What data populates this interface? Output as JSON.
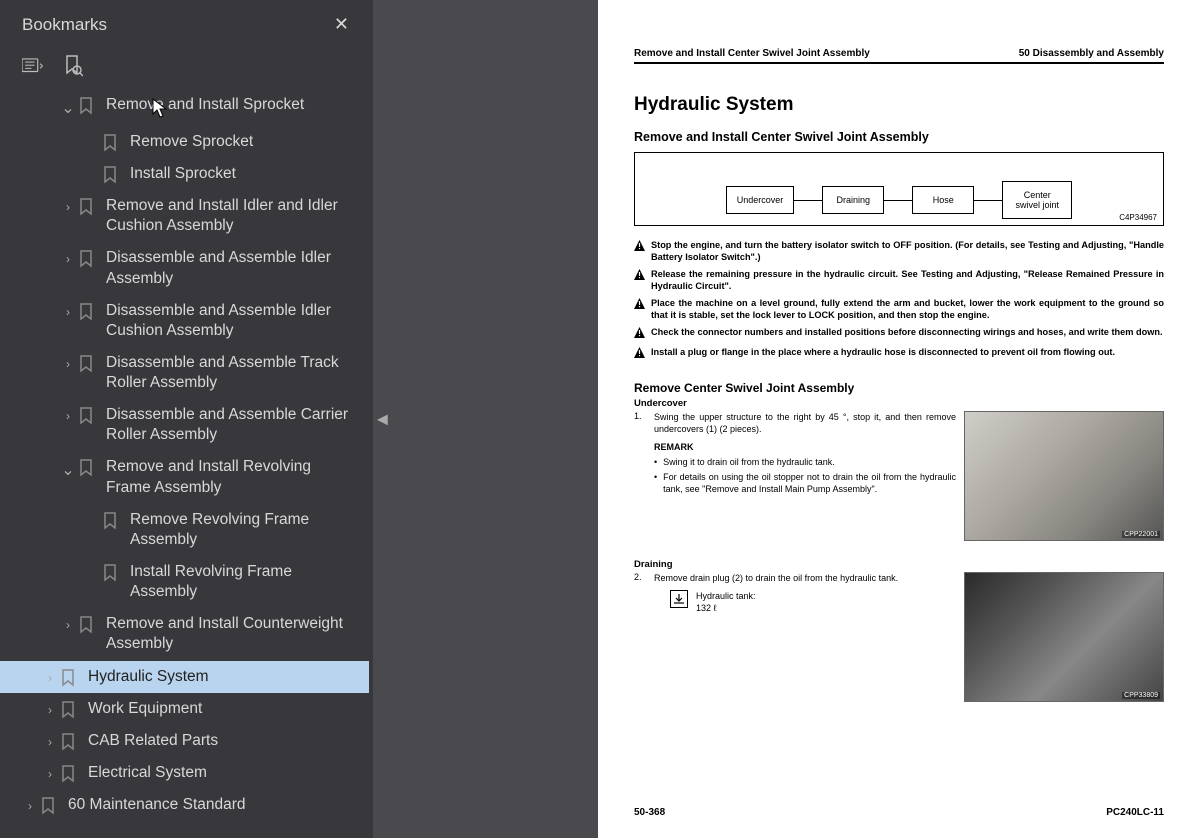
{
  "sidebar": {
    "title": "Bookmarks",
    "items": [
      {
        "indent": 3,
        "chev": "down",
        "label": "Remove and Install Sprocket"
      },
      {
        "indent": 4,
        "chev": "",
        "label": "Remove Sprocket"
      },
      {
        "indent": 4,
        "chev": "",
        "label": "Install Sprocket"
      },
      {
        "indent": 3,
        "chev": "right",
        "label": "Remove and Install Idler and Idler Cushion Assembly"
      },
      {
        "indent": 3,
        "chev": "right",
        "label": "Disassemble and Assemble Idler Assembly"
      },
      {
        "indent": 3,
        "chev": "right",
        "label": "Disassemble and Assemble Idler Cushion Assembly"
      },
      {
        "indent": 3,
        "chev": "right",
        "label": "Disassemble and Assemble Track Roller Assembly"
      },
      {
        "indent": 3,
        "chev": "right",
        "label": "Disassemble and Assemble Carrier Roller Assembly"
      },
      {
        "indent": 3,
        "chev": "down",
        "label": "Remove and Install Revolving Frame Assembly"
      },
      {
        "indent": 4,
        "chev": "",
        "label": "Remove Revolving Frame Assembly"
      },
      {
        "indent": 4,
        "chev": "",
        "label": "Install Revolving Frame Assembly"
      },
      {
        "indent": 3,
        "chev": "right",
        "label": "Remove and Install Counterweight Assembly"
      },
      {
        "indent": 2,
        "chev": "right",
        "label": "Hydraulic System",
        "selected": true
      },
      {
        "indent": 2,
        "chev": "right",
        "label": "Work Equipment"
      },
      {
        "indent": 2,
        "chev": "right",
        "label": "CAB Related Parts"
      },
      {
        "indent": 2,
        "chev": "right",
        "label": "Electrical System"
      },
      {
        "indent": 1,
        "chev": "right",
        "label": "60 Maintenance Standard"
      }
    ]
  },
  "doc": {
    "headerLeft": "Remove and Install Center Swivel Joint Assembly",
    "headerRight": "50 Disassembly and Assembly",
    "h1": "Hydraulic System",
    "h2": "Remove and Install Center Swivel Joint Assembly",
    "diagram": {
      "boxes": [
        "Undercover",
        "Draining",
        "Hose",
        "Center swivel joint"
      ],
      "code": "C4P34967"
    },
    "warnings": [
      "Stop the engine, and turn the battery isolator switch to OFF position. (For details, see Testing and Adjusting, \"Handle Battery Isolator Switch\".)",
      "Release the remaining pressure in the hydraulic circuit. See Testing and Adjusting, \"Release Remained Pressure in Hydraulic Circuit\".",
      "Place the machine on a level ground, fully extend the arm and bucket, lower the work equipment to the ground so that it is stable, set the lock lever to LOCK position, and then stop the engine.",
      "Check the connector numbers and installed positions before disconnecting wirings and hoses, and write them down.",
      "Install a plug or flange in the place where a hydraulic hose is disconnected to prevent oil from flowing out."
    ],
    "h3": "Remove Center Swivel Joint Assembly",
    "undercover": {
      "title": "Undercover",
      "num": "1.",
      "text": "Swing the upper structure to the right by 45 °, stop it, and then remove undercovers (1) (2 pieces).",
      "remark": "REMARK",
      "bullets": [
        "Swing it to drain oil from the hydraulic tank.",
        "For details on using the oil stopper not to drain the oil from the hydraulic tank, see \"Remove and Install Main Pump Assembly\"."
      ],
      "imgcode": "CPP22001"
    },
    "draining": {
      "title": "Draining",
      "num": "2.",
      "text": "Remove drain plug (2) to drain the oil from the hydraulic tank.",
      "tankLabel": "Hydraulic tank:",
      "tankVal": "132 ℓ",
      "imgcode": "CPP33809"
    },
    "footerLeft": "50-368",
    "footerRight": "PC240LC-11"
  }
}
